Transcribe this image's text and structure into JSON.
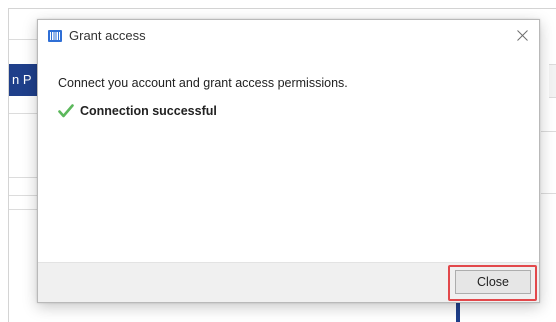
{
  "background_app": {
    "header_fragment": "n P"
  },
  "dialog": {
    "title": "Grant access",
    "app_icon": "barcode-app-icon",
    "close_icon": "close-x-icon",
    "instruction": "Connect you account and grant access permissions.",
    "status": {
      "icon": "green-check-icon",
      "text": "Connection successful",
      "color": "#5cb85c"
    },
    "footer": {
      "close_label": "Close",
      "highlight_color": "#e2484b"
    }
  }
}
